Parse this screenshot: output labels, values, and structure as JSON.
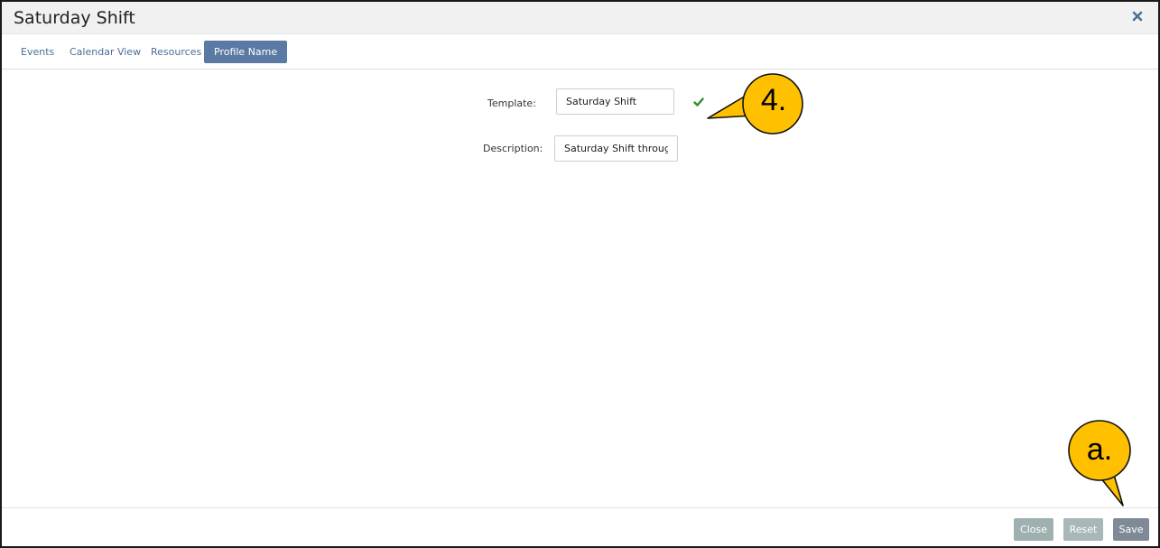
{
  "dialog": {
    "title": "Saturday Shift",
    "close_icon": "close-x-icon"
  },
  "tabs": [
    {
      "label": "Events",
      "active": false
    },
    {
      "label": "Calendar View",
      "active": false
    },
    {
      "label": "Resources",
      "active": false
    },
    {
      "label": "Profile Name",
      "active": true
    }
  ],
  "form": {
    "template_label": "Template:",
    "template_value": "Saturday Shift",
    "template_status_icon": "checkmark-icon",
    "description_label": "Description:",
    "description_value": "Saturday Shift through Q"
  },
  "footer": {
    "close_label": "Close",
    "reset_label": "Reset",
    "save_label": "Save"
  },
  "annotations": {
    "callout_1": "4.",
    "callout_2": "a."
  },
  "colors": {
    "tab_active": "#5a7aa3",
    "tab_text": "#4a6f96",
    "check": "#2e8b2e",
    "callout_fill": "#ffc000"
  }
}
